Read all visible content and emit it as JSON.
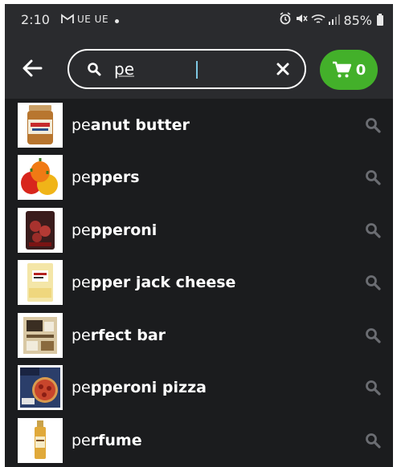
{
  "status_bar": {
    "time": "2:10",
    "carrier": "UE UE",
    "battery": "85%",
    "icons": [
      "gmail-icon",
      "alarm-icon",
      "mute-icon",
      "wifi-icon",
      "signal-icon",
      "battery-icon"
    ]
  },
  "header": {
    "search": {
      "value": "pe",
      "placeholder": ""
    },
    "cart_count": "0"
  },
  "colors": {
    "accent": "#43b02a",
    "background": "#1b1c1e",
    "bar": "#2a2b2e"
  },
  "suggestions": [
    {
      "prefix": "pe",
      "rest": "anut butter",
      "thumb": "peanut-butter-jar"
    },
    {
      "prefix": "pe",
      "rest": "ppers",
      "thumb": "bell-peppers"
    },
    {
      "prefix": "pe",
      "rest": "pperoni",
      "thumb": "pepperoni-pack"
    },
    {
      "prefix": "pe",
      "rest": "pper jack cheese",
      "thumb": "cheese-slices"
    },
    {
      "prefix": "pe",
      "rest": "rfect bar",
      "thumb": "perfect-bar-box"
    },
    {
      "prefix": "pe",
      "rest": "pperoni pizza",
      "thumb": "pizza-box"
    },
    {
      "prefix": "pe",
      "rest": "rfume",
      "thumb": "perfume-bottle"
    }
  ]
}
